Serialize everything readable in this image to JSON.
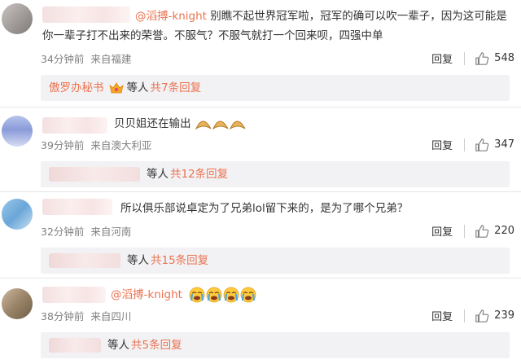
{
  "comments": [
    {
      "mention": "@滔搏-knight",
      "text": " 别瞧不起世界冠军啦，冠军的确可以吹一辈子，因为这可能是你一辈子打不出来的荣誉。不服气？不服气就打一个回来呗，四强中单",
      "time": "34分钟前",
      "location": "来自福建",
      "reply_label": "回复",
      "likes": "548",
      "reply_summary": {
        "name": "傲罗办秘书",
        "tail": "等人",
        "count": "共7条回复"
      }
    },
    {
      "mention": "",
      "text": "贝贝姐还在输出",
      "time": "39分钟前",
      "location": "来自澳大利亚",
      "reply_label": "回复",
      "likes": "347",
      "reply_summary": {
        "name": "",
        "tail": "等人",
        "count": "共12条回复"
      }
    },
    {
      "mention": "",
      "text": "所以俱乐部说卓定为了兄弟lol留下来的，是为了哪个兄弟？",
      "time": "32分钟前",
      "location": "来自河南",
      "reply_label": "回复",
      "likes": "220",
      "reply_summary": {
        "name": "",
        "tail": "等人",
        "count": "共15条回复"
      }
    },
    {
      "mention": "@滔搏-knight",
      "text": "",
      "time": "38分钟前",
      "location": "来自四川",
      "reply_label": "回复",
      "likes": "239",
      "reply_summary": {
        "name": "",
        "tail": "等人",
        "count": "共5条回复"
      }
    }
  ],
  "colors": {
    "mention": "#eb7350",
    "meta": "#808080",
    "reply_bg": "#f2f2f5"
  },
  "icons": {
    "like": "thumbs-up-icon",
    "fortune_cookie": "fortune-cookie-emoji",
    "crying": "crying-face-emoji",
    "crown": "crown-badge-icon"
  }
}
